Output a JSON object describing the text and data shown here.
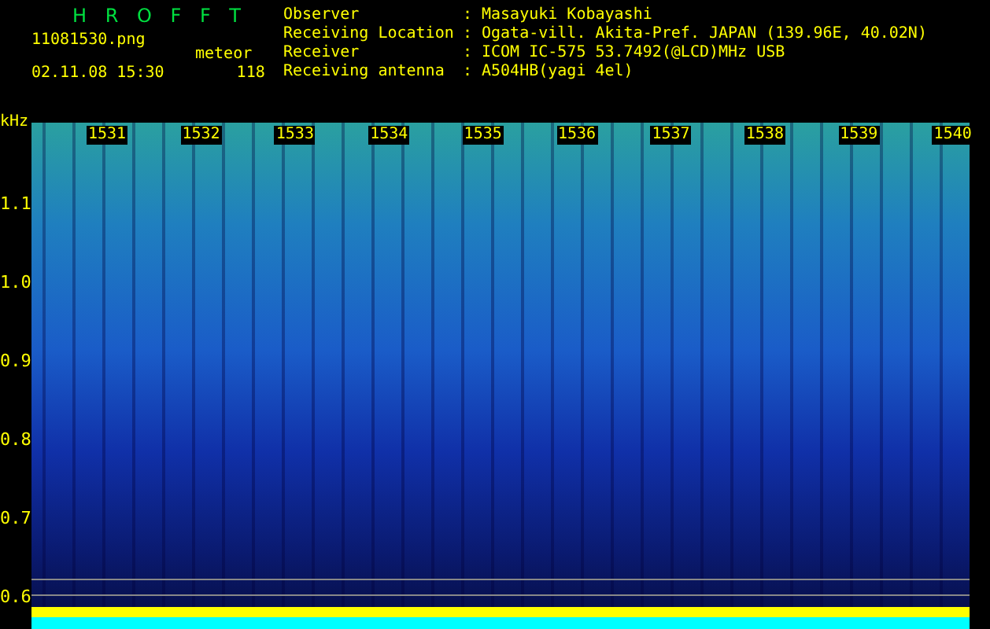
{
  "app_title": "H R O F F T",
  "file_name": "11081530.png",
  "meteor_label": "meteor",
  "date_time": "02.11.08 15:30",
  "meteor_count": "118",
  "info": [
    {
      "label": "Observer",
      "separator": ":",
      "value": "Masayuki Kobayashi"
    },
    {
      "label": "Receiving Location",
      "separator": ":",
      "value": "Ogata-vill. Akita-Pref. JAPAN (139.96E, 40.02N)"
    },
    {
      "label": "Receiver",
      "separator": ":",
      "value": "ICOM IC-575 53.7492(@LCD)MHz USB"
    },
    {
      "label": "Receiving antenna",
      "separator": ":",
      "value": "A504HB(yagi 4el)"
    }
  ],
  "y_axis": {
    "unit": "kHz",
    "ticks": [
      "1.1",
      "1.0",
      "0.9",
      "0.8",
      "0.7",
      "0.6"
    ]
  },
  "time_markers": [
    "1531",
    "1532",
    "1533",
    "1534",
    "1535",
    "1536",
    "1537",
    "1538",
    "1539",
    "1540"
  ]
}
